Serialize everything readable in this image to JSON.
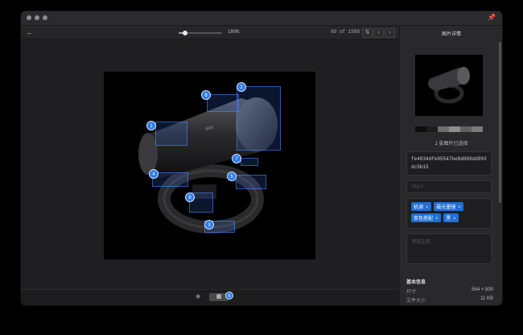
{
  "toolbar": {
    "zoom_label": "100%",
    "zoom_value": 0.15,
    "counter": "89 of 1588"
  },
  "sidebar": {
    "title": "图片详情",
    "selection_text": "1 张图片已选择",
    "palette": [
      "#0d0d0d",
      "#1c1c1c",
      "#6e6e6e",
      "#8c8c8c",
      "#606060",
      "#7a7a7a"
    ],
    "hash": "fe4034dfe85547be8d069dd993dc5b15",
    "url_placeholder": "http://",
    "tags": [
      "机调",
      "磁光墨镜",
      "单色搭配",
      "黑"
    ],
    "note_placeholder": "添加注释",
    "basic_info_title": "基本信息",
    "info": [
      {
        "label": "尺寸",
        "value": "564 × 500"
      },
      {
        "label": "文件大小",
        "value": "11 KB"
      }
    ]
  },
  "annotations": [
    {
      "label": "1"
    },
    {
      "label": "2"
    },
    {
      "label": "3"
    },
    {
      "label": "4"
    },
    {
      "label": "5"
    },
    {
      "label": "6"
    },
    {
      "label": "7"
    },
    {
      "label": "8"
    }
  ],
  "bottom": {
    "badge": "8"
  },
  "colors": {
    "accent": "#2f7be8",
    "tag_bg": "#1f6fd8"
  }
}
